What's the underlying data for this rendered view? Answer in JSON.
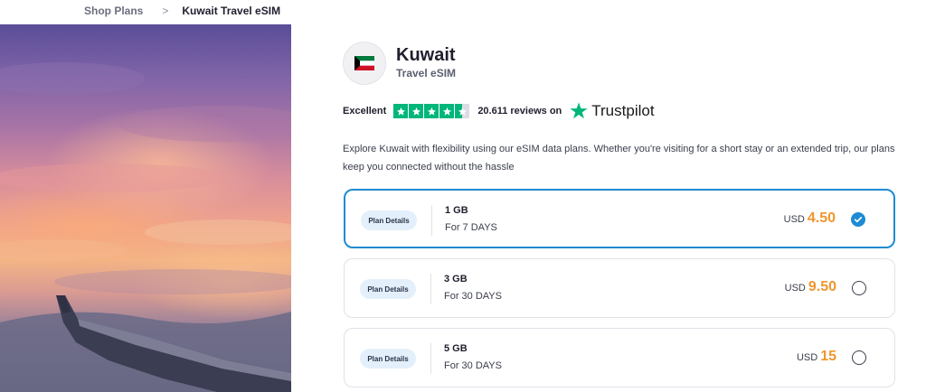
{
  "breadcrumb": {
    "parent": "Shop Plans",
    "separator": ">",
    "current": "Kuwait Travel eSIM"
  },
  "product": {
    "country": "Kuwait",
    "type": "Travel eSIM",
    "flag_icon": "kuwait-flag-icon"
  },
  "trustpilot": {
    "rating_label": "Excellent",
    "stars": 4.5,
    "reviews_text": "20.611 reviews on",
    "brand": "Trustpilot",
    "brand_color": "#00b67a"
  },
  "description": "Explore Kuwait with flexibility using our eSIM data plans. Whether you're visiting for a short stay or an extended trip, our plans keep you connected without the hassle",
  "plans": [
    {
      "details_label": "Plan Details",
      "data": "1 GB",
      "duration": "For 7 DAYS",
      "currency": "USD",
      "price": "4.50",
      "selected": true
    },
    {
      "details_label": "Plan Details",
      "data": "3 GB",
      "duration": "For 30 DAYS",
      "currency": "USD",
      "price": "9.50",
      "selected": false
    },
    {
      "details_label": "Plan Details",
      "data": "5 GB",
      "duration": "For 30 DAYS",
      "currency": "USD",
      "price": "15",
      "selected": false
    }
  ],
  "colors": {
    "accent": "#1f8bd2",
    "price": "#f0962c"
  }
}
